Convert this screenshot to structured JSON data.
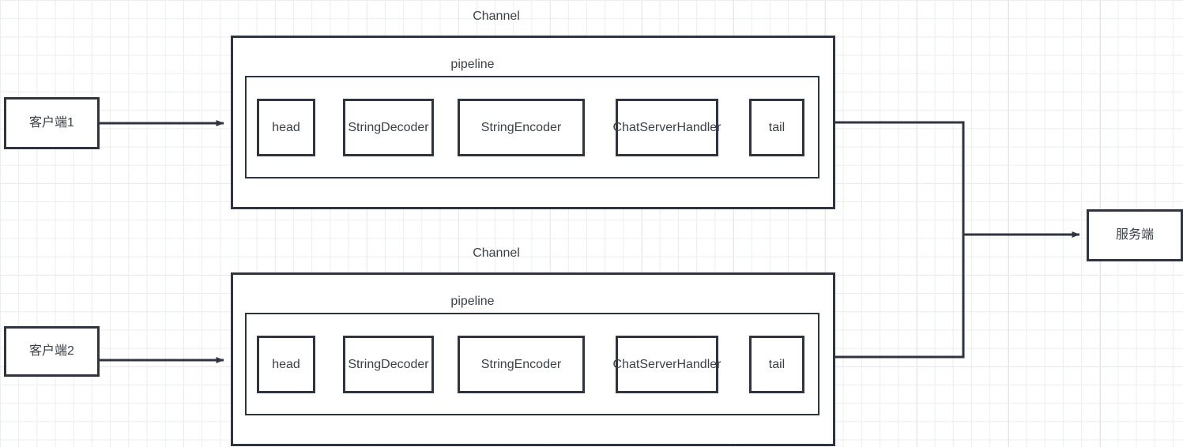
{
  "diagram": {
    "title_hidden": "",
    "colors": {
      "stroke": "#2e3440",
      "text": "#3b4148",
      "red_arrow": "#fa3c3c",
      "grid_minor": "#eceded",
      "grid_major": "#e2e4e4",
      "background": "#ffffff"
    },
    "clients": [
      {
        "label": "客户端1"
      },
      {
        "label": "客户端2"
      }
    ],
    "server": {
      "label": "服务端"
    },
    "channels": [
      {
        "label": "Channel",
        "pipeline_label": "pipeline",
        "handlers": [
          {
            "label": "head"
          },
          {
            "label": "StringDecoder"
          },
          {
            "label": "StringEncoder"
          },
          {
            "label": "ChatServerHandler"
          },
          {
            "label": "tail"
          }
        ]
      },
      {
        "label": "Channel",
        "pipeline_label": "pipeline",
        "handlers": [
          {
            "label": "head"
          },
          {
            "label": "StringDecoder"
          },
          {
            "label": "StringEncoder"
          },
          {
            "label": "ChatServerHandler"
          },
          {
            "label": "tail"
          }
        ]
      }
    ]
  }
}
